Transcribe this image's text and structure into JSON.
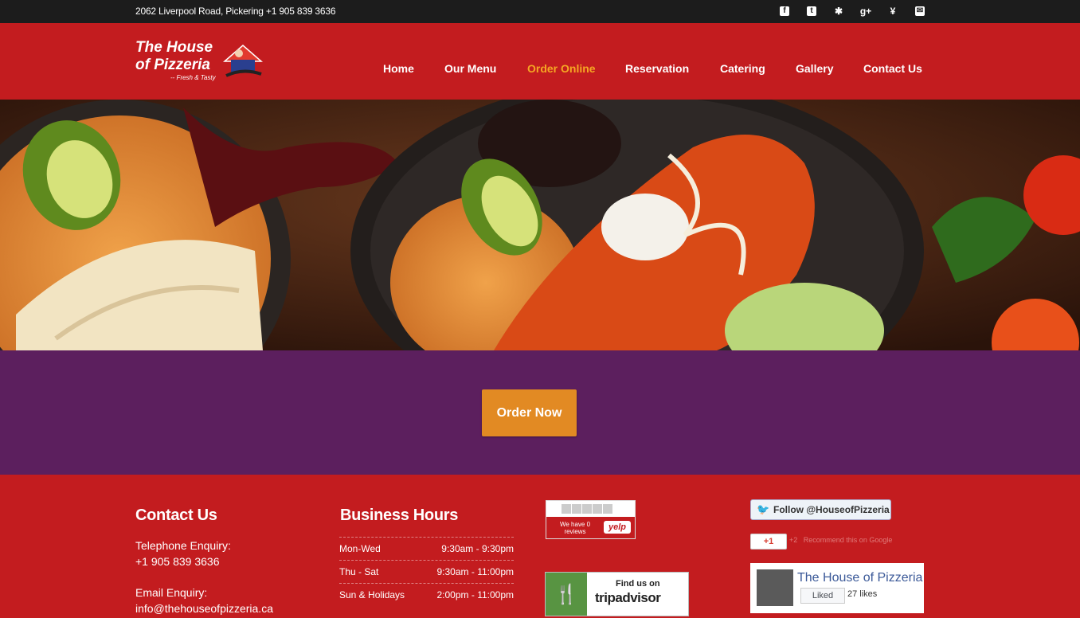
{
  "topbar": {
    "address": "2062 Liverpool Road, Pickering +1 905 839 3636",
    "social_icons": [
      "facebook-icon",
      "twitter-icon",
      "yelp-icon",
      "google-plus-icon",
      "foursquare-icon",
      "email-icon"
    ]
  },
  "logo": {
    "line1": "The House",
    "line2": "of Pizzeria",
    "tagline": "-- Fresh & Tasty"
  },
  "nav": {
    "items": [
      {
        "label": "Home"
      },
      {
        "label": "Our Menu"
      },
      {
        "label": "Order Online"
      },
      {
        "label": "Reservation"
      },
      {
        "label": "Catering"
      },
      {
        "label": "Gallery"
      },
      {
        "label": "Contact Us"
      }
    ],
    "active": "Order Online"
  },
  "cta": {
    "label": "Order Now"
  },
  "footer": {
    "contact": {
      "heading": "Contact Us",
      "phone_label": "Telephone Enquiry:",
      "phone": "+1 905 839 3636",
      "email_label": "Email Enquiry:",
      "email": "info@thehouseofpizzeria.ca"
    },
    "hours": {
      "heading": "Business Hours",
      "rows": [
        {
          "days": "Mon-Wed",
          "time": "9:30am - 9:30pm"
        },
        {
          "days": "Thu - Sat",
          "time": "9:30am - 11:00pm"
        },
        {
          "days": "Sun & Holidays",
          "time": "2:00pm - 11:00pm"
        }
      ]
    },
    "yelp": {
      "text": "We have 0 reviews",
      "brand": "yelp"
    },
    "tripadvisor": {
      "line1": "Find us on",
      "brand": "tripadvisor"
    },
    "twitter": {
      "label": "Follow @HouseofPizzeria"
    },
    "gplus": {
      "label": "+1",
      "count": "+2",
      "recommend": "Recommend this on Google"
    },
    "facebook": {
      "name": "The House of Pizzeria",
      "liked": "Liked",
      "likes": "27 likes"
    }
  },
  "colors": {
    "topbar": "#1c1c1c",
    "brand_red": "#c31c1f",
    "purple_band": "#5c1f5e",
    "active_nav": "#f5a623",
    "button_orange": "#e28a23"
  }
}
